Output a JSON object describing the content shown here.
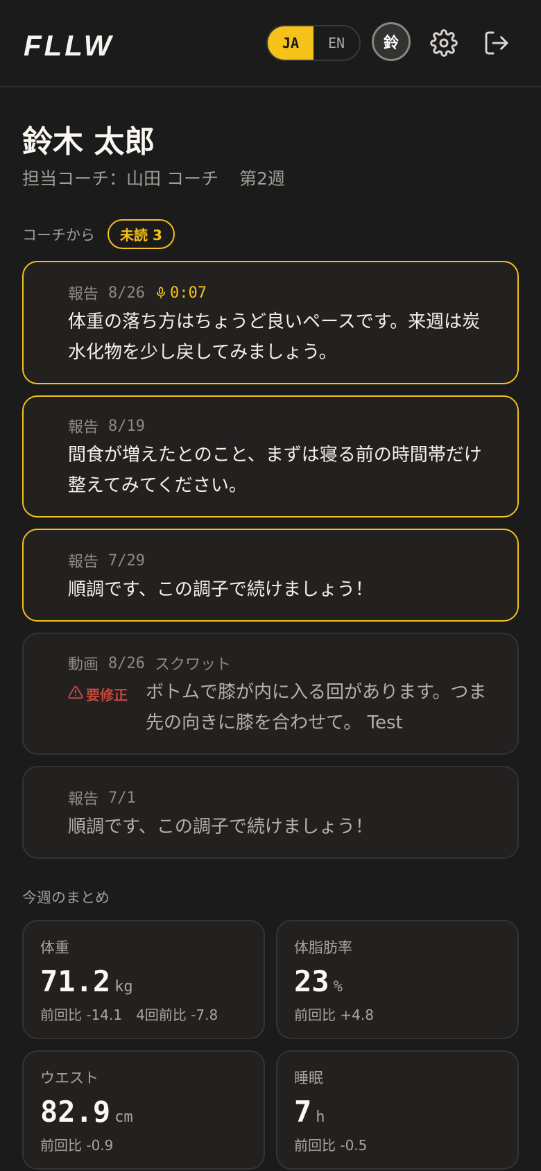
{
  "header": {
    "logo": "FLLW",
    "lang_active": "JA",
    "lang_inactive": "EN",
    "avatar_initial": "鈴",
    "settings_icon": "gear-icon",
    "logout_icon": "logout-icon"
  },
  "profile": {
    "name": "鈴木 太郎",
    "coach": "担当コーチ：山田 コーチ",
    "week": "第2週"
  },
  "messages_section": {
    "label": "コーチから",
    "unread_badge": "未読 3"
  },
  "messages": [
    {
      "type": "報告",
      "date": "8/26",
      "audio": "0:07",
      "text": "体重の落ち方はちょうど良いペースです。来週は炭水化物を少し戻してみましょう。",
      "unread": true
    },
    {
      "type": "報告",
      "date": "8/19",
      "text": "間食が増えたとのこと、まずは寝る前の時間帯だけ整えてみてください。",
      "unread": true
    },
    {
      "type": "報告",
      "date": "7/29",
      "text": "順調です、この調子で続けましょう！",
      "unread": true
    },
    {
      "type": "動画",
      "date": "8/26",
      "exercise": "スクワット",
      "status": "要修正",
      "text": "ボトムで膝が内に入る回があります。つま先の向きに膝を合わせて。 Test",
      "unread": false
    },
    {
      "type": "報告",
      "date": "7/1",
      "text": "順調です、この調子で続けましょう！",
      "unread": false
    }
  ],
  "summary": {
    "title": "今週のまとめ",
    "cards": [
      {
        "label": "体重",
        "value": "71.2",
        "unit": "kg",
        "delta": "前回比 -14.1",
        "delta2": "4回前比 -7.8"
      },
      {
        "label": "体脂肪率",
        "value": "23",
        "unit": "%",
        "delta": "前回比 +4.8"
      },
      {
        "label": "ウエスト",
        "value": "82.9",
        "unit": "cm",
        "delta": "前回比 -0.9"
      },
      {
        "label": "睡眠",
        "value": "7",
        "unit": "h",
        "delta": "前回比 -0.5"
      }
    ]
  },
  "colors": {
    "accent": "#f5c21b",
    "background": "#1c1b1b",
    "card": "#222120",
    "warning": "#c4473c"
  }
}
